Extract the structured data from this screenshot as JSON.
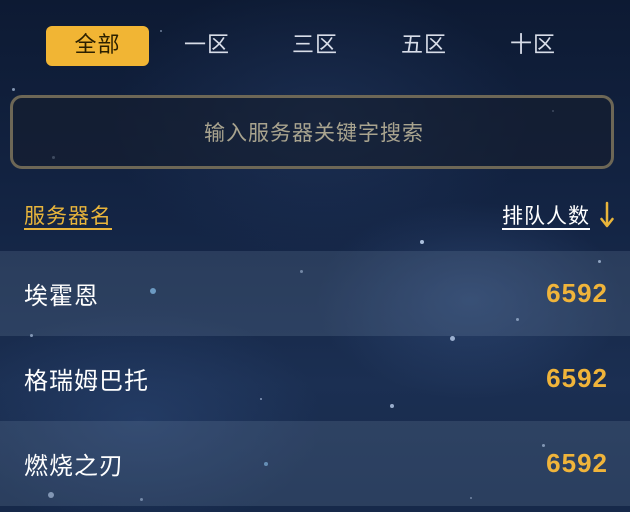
{
  "tabs": [
    {
      "label": "全部",
      "active": true
    },
    {
      "label": "一区",
      "active": false
    },
    {
      "label": "三区",
      "active": false
    },
    {
      "label": "五区",
      "active": false
    },
    {
      "label": "十区",
      "active": false
    }
  ],
  "search": {
    "placeholder": "输入服务器关键字搜索",
    "value": ""
  },
  "header": {
    "server_name_label": "服务器名",
    "queue_count_label": "排队人数",
    "sort_icon": "arrow-down-icon",
    "sort_direction": "descending"
  },
  "servers": [
    {
      "name": "埃霍恩",
      "queue": "6592"
    },
    {
      "name": "格瑞姆巴托",
      "queue": "6592"
    },
    {
      "name": "燃烧之刃",
      "queue": "6592"
    }
  ],
  "colors": {
    "accent": "#f1b534",
    "number": "#f0b43a",
    "background": "#142545"
  }
}
